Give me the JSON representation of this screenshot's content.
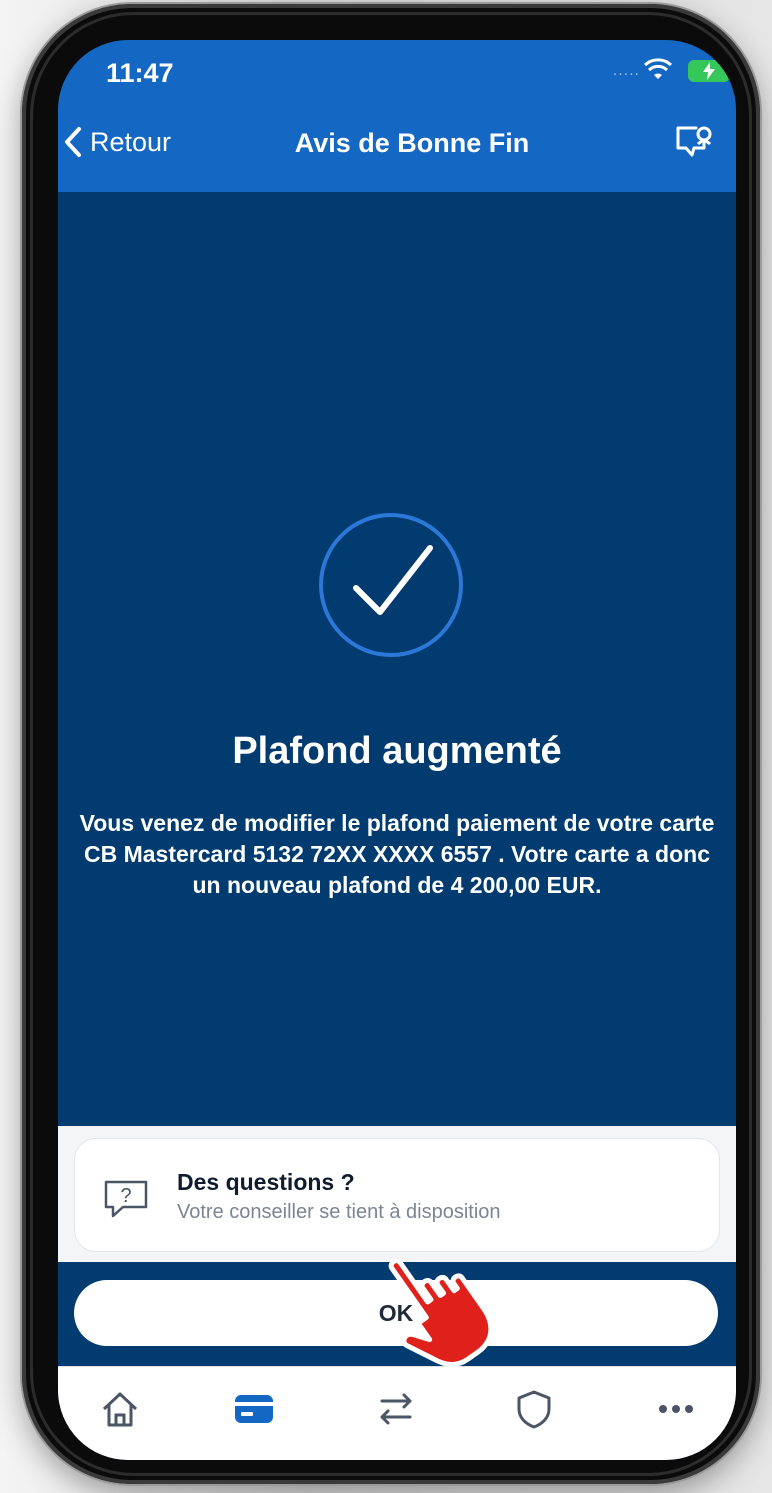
{
  "status_bar": {
    "time": "11:47",
    "signal_dots": "....."
  },
  "nav": {
    "back_label": "Retour",
    "title": "Avis de Bonne Fin",
    "right_icon": "chat-support-icon"
  },
  "confirmation": {
    "icon": "check-circle-icon",
    "title": "Plafond augmenté",
    "message": "Vous venez de modifier le plafond paiement de votre carte CB Mastercard 5132 72XX XXXX 6557 . Votre carte a donc un nouveau plafond de 4 200,00 EUR."
  },
  "help_card": {
    "icon": "question-bubble-icon",
    "title": "Des questions ?",
    "subtitle": "Votre conseiller se tient à disposition"
  },
  "actions": {
    "ok_label": "OK"
  },
  "tabbar": {
    "items": [
      {
        "icon": "home-icon",
        "active": false
      },
      {
        "icon": "card-icon",
        "active": true
      },
      {
        "icon": "transfer-icon",
        "active": false
      },
      {
        "icon": "shield-icon",
        "active": false
      },
      {
        "icon": "more-icon",
        "active": false
      }
    ]
  },
  "colors": {
    "header_blue": "#1467c2",
    "content_navy": "#023b70",
    "accent_circle": "#2c78d8",
    "tab_active": "#1467c2",
    "pointer_red": "#e0201b"
  }
}
